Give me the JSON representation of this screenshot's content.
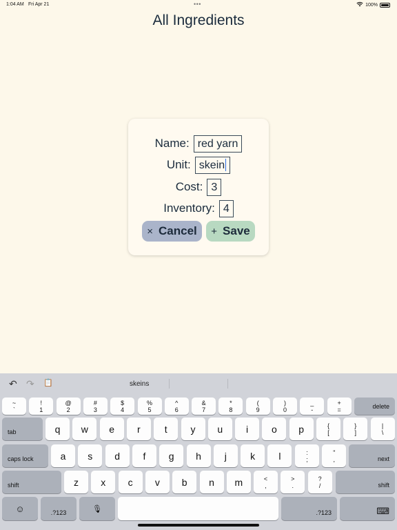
{
  "status_bar": {
    "time": "1:04 AM",
    "date": "Fri Apr 21",
    "multitask_dots": "•••",
    "battery_percent": "100%",
    "wifi_icon": "wifi-icon",
    "battery_level": 1.0
  },
  "page": {
    "title": "All Ingredients"
  },
  "dialog": {
    "name_label": "Name:",
    "name_value": "red yarn",
    "unit_label": "Unit:",
    "unit_value": "skein",
    "cost_label": "Cost:",
    "cost_value": "3",
    "inventory_label": "Inventory:",
    "inventory_value": "4",
    "cancel": {
      "icon": "×",
      "label": "Cancel"
    },
    "save": {
      "icon": "+",
      "label": "Save"
    }
  },
  "keyboard": {
    "suggestion_icons": {
      "undo": "↶",
      "redo": "↷",
      "clipboard": "📋"
    },
    "suggestion": "skeins",
    "number_row": [
      {
        "top": "~",
        "bottom": "`"
      },
      {
        "top": "!",
        "bottom": "1"
      },
      {
        "top": "@",
        "bottom": "2"
      },
      {
        "top": "#",
        "bottom": "3"
      },
      {
        "top": "$",
        "bottom": "4"
      },
      {
        "top": "%",
        "bottom": "5"
      },
      {
        "top": "^",
        "bottom": "6"
      },
      {
        "top": "&",
        "bottom": "7"
      },
      {
        "top": "*",
        "bottom": "8"
      },
      {
        "top": "(",
        "bottom": "9"
      },
      {
        "top": ")",
        "bottom": "0"
      },
      {
        "top": "_",
        "bottom": "-"
      },
      {
        "top": "+",
        "bottom": "="
      }
    ],
    "delete": "delete",
    "tab": "tab",
    "row_q": [
      "q",
      "w",
      "e",
      "r",
      "t",
      "y",
      "u",
      "i",
      "o",
      "p"
    ],
    "row_q_extra": [
      {
        "top": "{",
        "bottom": "["
      },
      {
        "top": "}",
        "bottom": "]"
      },
      {
        "top": "|",
        "bottom": "\\"
      }
    ],
    "caps_lock": "caps lock",
    "row_a": [
      "a",
      "s",
      "d",
      "f",
      "g",
      "h",
      "j",
      "k",
      "l"
    ],
    "row_a_extra": [
      {
        "top": ":",
        "bottom": ";"
      },
      {
        "top": "\"",
        "bottom": ","
      }
    ],
    "next": "next",
    "shift": "shift",
    "row_z": [
      "z",
      "x",
      "c",
      "v",
      "b",
      "n",
      "m"
    ],
    "row_z_extra": [
      {
        "top": "<",
        "bottom": ","
      },
      {
        "top": ">",
        "bottom": "."
      },
      {
        "top": "?",
        "bottom": "/"
      }
    ],
    "emoji": "☺",
    "numbers_left": ".?123",
    "mic": "🎙",
    "numbers_right": ".?123",
    "hide_keyboard": "⌨"
  }
}
